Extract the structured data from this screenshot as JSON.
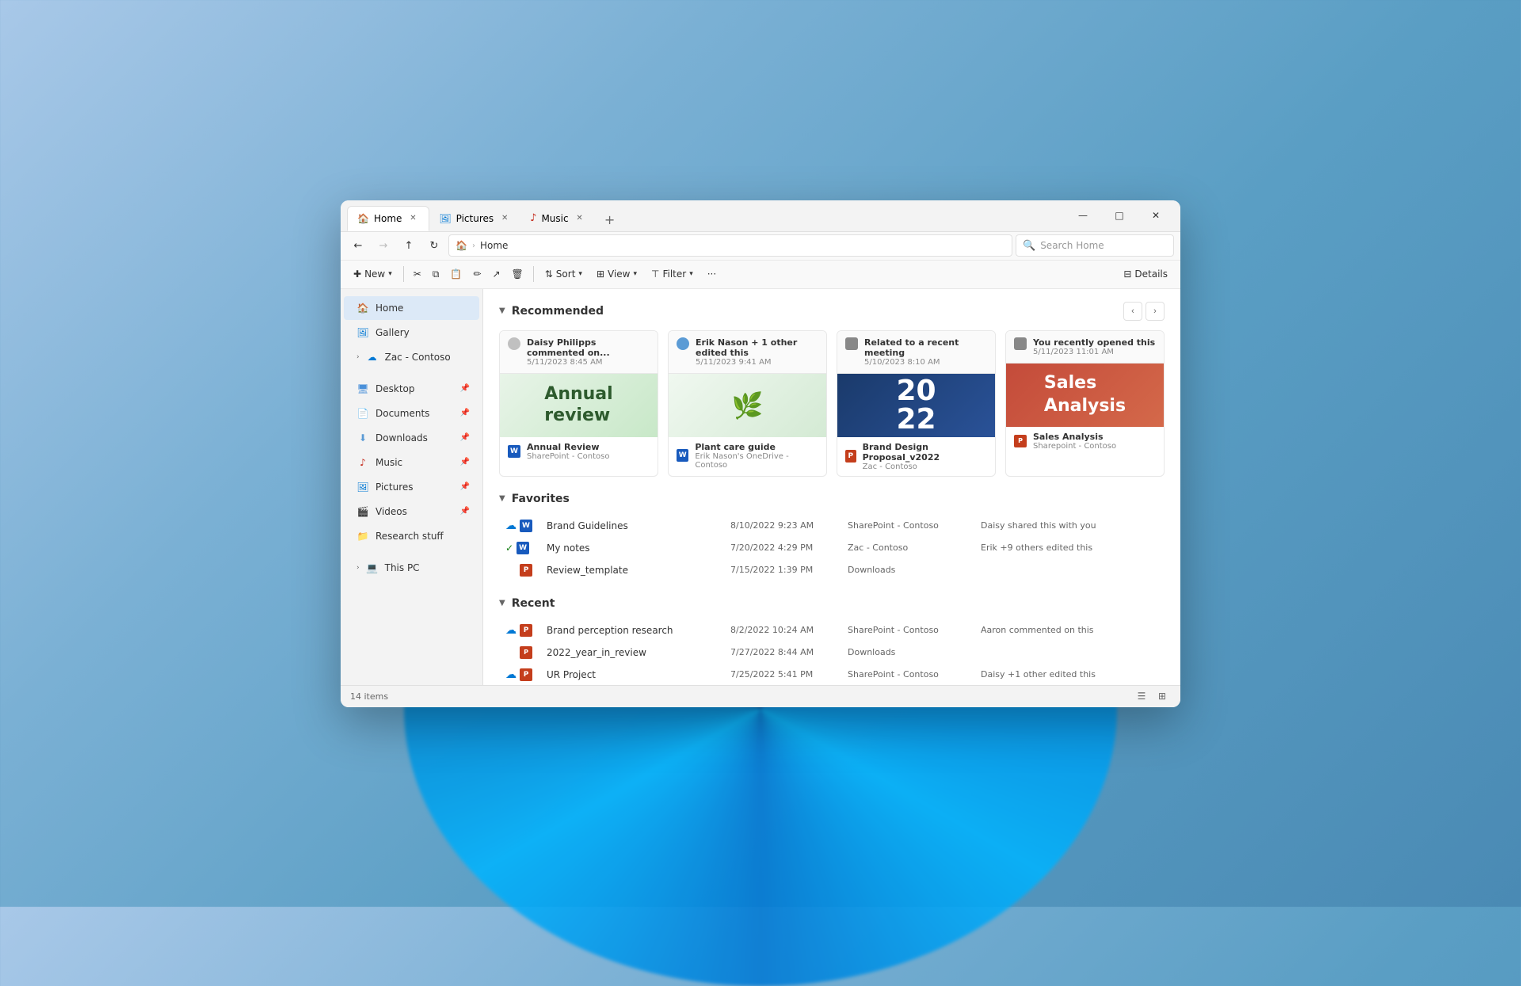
{
  "window": {
    "title": "Home",
    "tabs": [
      {
        "label": "Home",
        "icon": "home",
        "active": true
      },
      {
        "label": "Pictures",
        "icon": "pictures",
        "active": false
      },
      {
        "label": "Music",
        "icon": "music",
        "active": false
      }
    ],
    "add_tab_label": "+",
    "controls": {
      "minimize": "—",
      "maximize": "□",
      "close": "✕"
    }
  },
  "navbar": {
    "back_tooltip": "Back",
    "forward_tooltip": "Forward",
    "up_tooltip": "Up",
    "refresh_tooltip": "Refresh",
    "home_tooltip": "Home",
    "address": "Home",
    "search_placeholder": "Search Home"
  },
  "toolbar": {
    "new_label": "New",
    "cut_tooltip": "Cut",
    "copy_tooltip": "Copy",
    "paste_tooltip": "Paste",
    "rename_tooltip": "Rename",
    "share_tooltip": "Share",
    "delete_tooltip": "Delete",
    "sort_label": "Sort",
    "view_label": "View",
    "filter_label": "Filter",
    "more_tooltip": "More",
    "details_label": "Details"
  },
  "sidebar": {
    "items": [
      {
        "label": "Home",
        "icon": "home",
        "active": true,
        "pinned": false
      },
      {
        "label": "Gallery",
        "icon": "gallery",
        "active": false,
        "pinned": false
      },
      {
        "label": "Zac - Contoso",
        "icon": "onedrive",
        "active": false,
        "pinned": false,
        "expandable": true
      }
    ],
    "quick_access": [
      {
        "label": "Desktop",
        "icon": "desktop",
        "pinned": true
      },
      {
        "label": "Documents",
        "icon": "documents",
        "pinned": true
      },
      {
        "label": "Downloads",
        "icon": "downloads",
        "pinned": true
      },
      {
        "label": "Music",
        "icon": "music",
        "pinned": true
      },
      {
        "label": "Pictures",
        "icon": "pictures",
        "pinned": true
      },
      {
        "label": "Videos",
        "icon": "videos",
        "pinned": true
      },
      {
        "label": "Research stuff",
        "icon": "folder",
        "pinned": false
      }
    ],
    "this_pc": {
      "label": "This PC",
      "expandable": true
    }
  },
  "recommended": {
    "section_title": "Recommended",
    "cards": [
      {
        "user": "Daisy Philipps commented on...",
        "date": "5/11/2023 8:45 AM",
        "preview_type": "annual_review",
        "file_name": "Annual Review",
        "location": "SharePoint - Contoso"
      },
      {
        "user": "Erik Nason + 1 other edited this",
        "date": "5/11/2023 9:41 AM",
        "preview_type": "plant_care",
        "file_name": "Plant care guide",
        "location": "Erik Nason's OneDrive - Contoso"
      },
      {
        "user": "Related to a recent meeting",
        "date": "5/10/2023 8:10 AM",
        "preview_type": "brand_design",
        "file_name": "Brand Design Proposal_v2022",
        "location": "Zac - Contoso"
      },
      {
        "user": "You recently opened this",
        "date": "5/11/2023 11:01 AM",
        "preview_type": "sales_analysis",
        "file_name": "Sales Analysis",
        "location": "Sharepoint - Contoso"
      }
    ]
  },
  "favorites": {
    "section_title": "Favorites",
    "items": [
      {
        "name": "Brand Guidelines",
        "date": "8/10/2022 9:23 AM",
        "location": "SharePoint - Contoso",
        "activity": "Daisy shared this with you",
        "cloud": true,
        "type": "word"
      },
      {
        "name": "My notes",
        "date": "7/20/2022 4:29 PM",
        "location": "Zac - Contoso",
        "activity": "Erik +9 others edited this",
        "cloud": true,
        "type": "word"
      },
      {
        "name": "Review_template",
        "date": "7/15/2022 1:39 PM",
        "location": "Downloads",
        "activity": "",
        "cloud": false,
        "type": "ppt"
      }
    ]
  },
  "recent": {
    "section_title": "Recent",
    "items": [
      {
        "name": "Brand perception research",
        "date": "8/2/2022 10:24 AM",
        "location": "SharePoint - Contoso",
        "activity": "Aaron commented on this",
        "cloud": true,
        "type": "ppt"
      },
      {
        "name": "2022_year_in_review",
        "date": "7/27/2022 8:44 AM",
        "location": "Downloads",
        "activity": "",
        "cloud": false,
        "type": "pdf"
      },
      {
        "name": "UR Project",
        "date": "7/25/2022 5:41 PM",
        "location": "SharePoint - Contoso",
        "activity": "Daisy +1 other edited this",
        "cloud": true,
        "type": "ppt"
      }
    ]
  },
  "status_bar": {
    "items_count": "14 items"
  }
}
